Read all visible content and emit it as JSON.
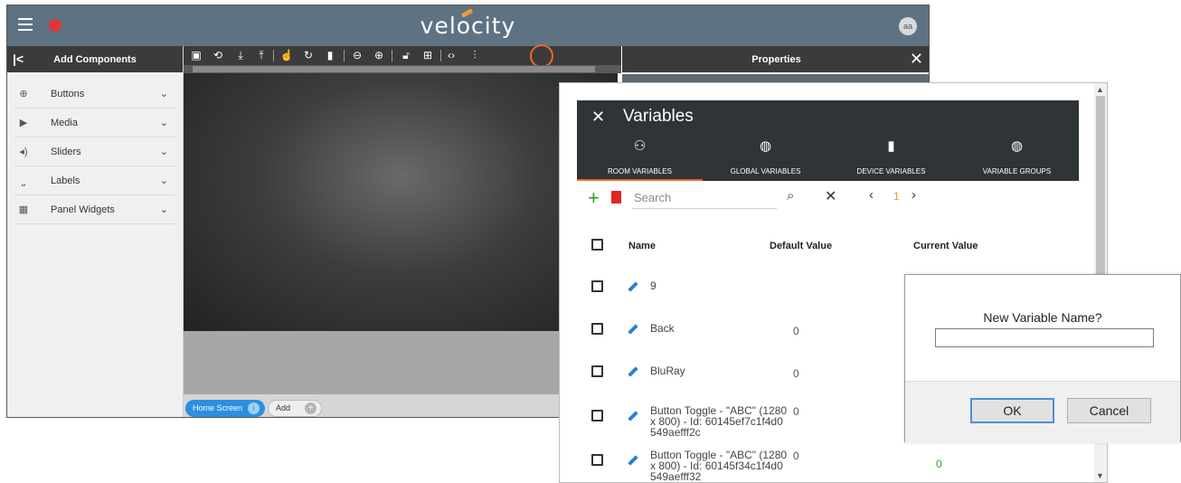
{
  "app": {
    "brand": "velocity",
    "user_initials": "aa",
    "accent_color": "#e86c23",
    "header_color": "#5d7383"
  },
  "left_panel": {
    "title": "Add Components",
    "items": [
      {
        "label": "Buttons",
        "icon": "plus-circle-icon"
      },
      {
        "label": "Media",
        "icon": "play-circle-icon"
      },
      {
        "label": "Sliders",
        "icon": "volume-icon"
      },
      {
        "label": "Labels",
        "icon": "label-icon"
      },
      {
        "label": "Panel Widgets",
        "icon": "widgets-icon"
      }
    ]
  },
  "toolbar": {
    "icons": [
      "layout-icon",
      "rotate-icon",
      "download-icon",
      "upload-icon",
      "touch-icon",
      "refresh-icon",
      "device-icon",
      "zoom-out-icon",
      "zoom-in-icon",
      "lock-icon",
      "grid-icon",
      "code-icon",
      "settings-sliders-icon"
    ]
  },
  "pages": {
    "home_tab": "Home Screen",
    "add_tab": "Add"
  },
  "properties": {
    "title": "Properties"
  },
  "variables": {
    "title": "Variables",
    "tabs": [
      {
        "label": "ROOM VARIABLES",
        "icon": "room-icon",
        "active": true
      },
      {
        "label": "GLOBAL VARIABLES",
        "icon": "globe-icon",
        "active": false
      },
      {
        "label": "DEVICE VARIABLES",
        "icon": "device-icon",
        "active": false
      },
      {
        "label": "VARIABLE GROUPS",
        "icon": "globe-icon",
        "active": false
      }
    ],
    "search_placeholder": "Search",
    "page": "1",
    "columns": {
      "name": "Name",
      "default": "Default Value",
      "current": "Current Value"
    },
    "rows": [
      {
        "name": "9",
        "default": "",
        "current": ""
      },
      {
        "name": "Back",
        "default": "0",
        "current": ""
      },
      {
        "name": "BluRay",
        "default": "0",
        "current": ""
      },
      {
        "name": "Button Toggle - \"ABC\" (1280 x 800) - Id: 60145ef7c1f4d0549aefff2c",
        "default": "0",
        "current": ""
      },
      {
        "name": "Button Toggle - \"ABC\" (1280 x 800) - Id: 60145f34c1f4d0549aefff32",
        "default": "0",
        "current": "0"
      }
    ]
  },
  "prompt": {
    "question": "New Variable Name?",
    "value": "",
    "ok": "OK",
    "cancel": "Cancel"
  }
}
